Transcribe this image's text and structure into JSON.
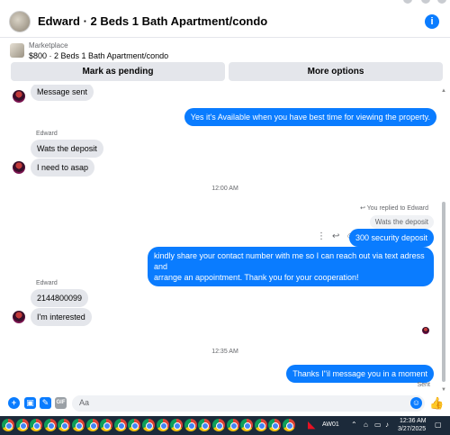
{
  "header": {
    "title": "Edward · 2 Beds 1 Bath Apartment/condo",
    "info_glyph": "i"
  },
  "marketplace": {
    "label": "Marketplace",
    "listing": "$800 · 2 Beds 1 Bath Apartment/condo"
  },
  "actions": {
    "mark_pending": "Mark as pending",
    "more_options": "More options"
  },
  "messages": {
    "m1": "Message sent",
    "m2": "Yes it's Available when you have best time for viewing the property.",
    "sender1": "Edward",
    "m3": "Wats the deposit",
    "m4": "I need to asap",
    "ts1": "12:00 AM",
    "reply_note": "You replied to Edward",
    "reply_quote": "Wats the deposit",
    "m5": "300 security deposit",
    "m6_line1": "kindly share your contact number with me so I can reach out via text adress and",
    "m6_line2": "arrange an appointment. Thank you for your cooperation!",
    "sender2": "Edward",
    "m7": "2144800099",
    "m8": "I'm interested",
    "ts2": "12:35 AM",
    "m9": "Thanks I\"il message you in a moment",
    "status": "Sent"
  },
  "composer": {
    "placeholder": "Aa"
  },
  "taskbar": {
    "app_label": "AW01",
    "time": "12:36 AM",
    "date": "3/27/2025",
    "app_count": 21
  },
  "colors": {
    "accent": "#0a7cff",
    "incoming": "#e4e6eb",
    "taskbar": "#1c2a3a"
  }
}
